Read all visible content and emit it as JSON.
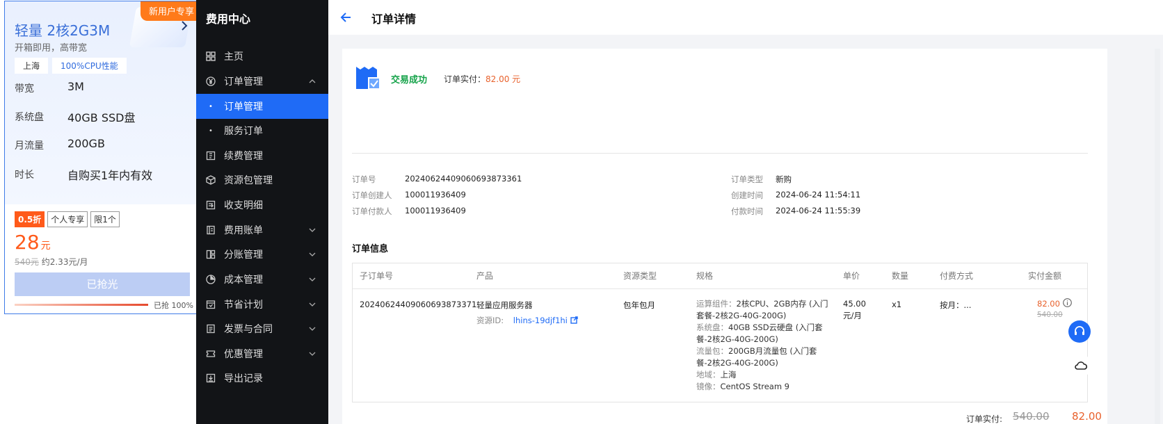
{
  "promo": {
    "badge": "新用户专享",
    "title": "轻量 2核2G3M",
    "subtitle": "开箱即用，高带宽",
    "tags": [
      "上海",
      "100%CPU性能"
    ],
    "specs": [
      {
        "label": "带宽",
        "value": "3M"
      },
      {
        "label": "系统盘",
        "value": "40GB SSD盘"
      },
      {
        "label": "月流量",
        "value": "200GB"
      },
      {
        "label": "时长",
        "value": "自购买1年内有效"
      }
    ],
    "discount_tags": [
      "0.5折",
      "个人专享",
      "限1个"
    ],
    "price": "28",
    "price_unit": "元",
    "original_price": "540元",
    "monthly": "约2.33元/月",
    "button_label": "已抢光",
    "sold_text": "已抢 100%",
    "sold_percent": 100
  },
  "sidebar": {
    "title": "费用中心",
    "items": [
      {
        "label": "主页",
        "icon": "grid-icon"
      },
      {
        "label": "订单管理",
        "icon": "yen-circle-icon",
        "expanded": true
      },
      {
        "label": "订单管理",
        "sub": true,
        "active": true
      },
      {
        "label": "服务订单",
        "sub": true
      },
      {
        "label": "续费管理",
        "icon": "renew-icon"
      },
      {
        "label": "资源包管理",
        "icon": "package-icon"
      },
      {
        "label": "收支明细",
        "icon": "ledger-icon"
      },
      {
        "label": "费用账单",
        "icon": "bill-icon",
        "collapsible": true
      },
      {
        "label": "分账管理",
        "icon": "split-icon",
        "collapsible": true
      },
      {
        "label": "成本管理",
        "icon": "pie-icon",
        "collapsible": true
      },
      {
        "label": "节省计划",
        "icon": "plan-icon",
        "collapsible": true
      },
      {
        "label": "发票与合同",
        "icon": "invoice-icon",
        "collapsible": true
      },
      {
        "label": "优惠管理",
        "icon": "coupon-icon",
        "collapsible": true
      },
      {
        "label": "导出记录",
        "icon": "export-icon"
      }
    ]
  },
  "header": {
    "title": "订单详情"
  },
  "order": {
    "status": "交易成功",
    "paid_label": "订单实付：",
    "paid_amount": "82.00 元",
    "fields_left": [
      {
        "label": "订单号",
        "value": "20240624409060693873361"
      },
      {
        "label": "订单创建人",
        "value": "100011936409"
      },
      {
        "label": "订单付款人",
        "value": "100011936409"
      }
    ],
    "fields_right": [
      {
        "label": "订单类型",
        "value": "新购"
      },
      {
        "label": "创建时间",
        "value": "2024-06-24 11:54:11"
      },
      {
        "label": "付款时间",
        "value": "2024-06-24 11:55:39"
      }
    ]
  },
  "table": {
    "section_title": "订单信息",
    "headers": [
      "子订单号",
      "产品",
      "资源类型",
      "规格",
      "单价",
      "数量",
      "付费方式",
      "实付金额"
    ],
    "row": {
      "sub_order": "20240624409060693873371",
      "product": "轻量应用服务器",
      "resource_label": "资源ID:",
      "resource_id": "lhins-19djf1hi",
      "resource_type": "包年包月",
      "specs": [
        {
          "key": "运算组件：",
          "value": "2核CPU、2GB内存 (入门套餐-2核2G-40G-200G)"
        },
        {
          "key": "系统盘：",
          "value": "40GB SSD云硬盘 (入门套餐-2核2G-40G-200G)"
        },
        {
          "key": "流量包：",
          "value": "200GB月流量包 (入门套餐-2核2G-40G-200G)"
        },
        {
          "key": "地域：",
          "value": "上海"
        },
        {
          "key": "镜像：",
          "value": "CentOS Stream 9"
        }
      ],
      "unit_price": "45.00 元/月",
      "quantity": "x1",
      "billing": "按月：...",
      "paid": "82.00",
      "original": "540.00"
    }
  },
  "total": {
    "label": "订单实付:",
    "original": "540.00",
    "amount": "82.00"
  },
  "colors": {
    "accent": "#1f6bf6",
    "success": "#16a34a",
    "price": "#e8612c",
    "sidebar_bg": "#121417"
  }
}
